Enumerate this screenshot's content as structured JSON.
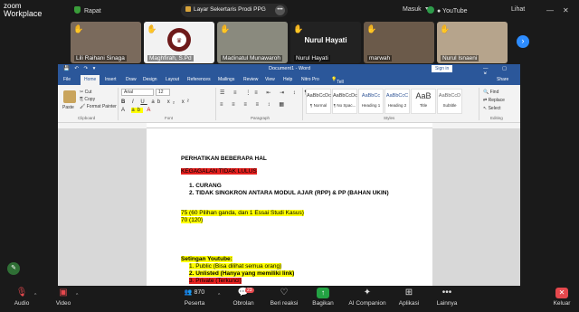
{
  "app": {
    "logo_line1": "zoom",
    "logo_line2": "Workplace"
  },
  "meeting": {
    "title": "Rapat"
  },
  "share": {
    "label": "Layar Sekertaris Prodi PPG"
  },
  "topbar": {
    "signin_label": "Masuk",
    "youtube_label": "YouTube",
    "view_label": "Lihat"
  },
  "participants": [
    {
      "name": "Lili Raihani  Sinaga",
      "hand": "✋",
      "bg": "#7a6a5c"
    },
    {
      "name": "Maghfirah, S.Pd",
      "hand": "✋",
      "bg": "#f2f2f2"
    },
    {
      "name": "Madinatul Munawaroh",
      "hand": "✋",
      "bg": "#8a8a7e"
    },
    {
      "name": "Nurul Hayati",
      "hand": "✋",
      "bg": "#222",
      "big_name": "Nurul Hayati"
    },
    {
      "name": "marwah",
      "hand": "✋",
      "bg": "#6b5a4a"
    },
    {
      "name": "Nurul Isnaeni",
      "hand": "✋",
      "bg": "#b6a48c"
    }
  ],
  "word": {
    "window_title": "Document1  -  Word",
    "signin": "Sign in",
    "share": "Share",
    "tabs": [
      "File",
      "Home",
      "Insert",
      "Draw",
      "Design",
      "Layout",
      "References",
      "Mailings",
      "Review",
      "View",
      "Help",
      "Nitro Pro",
      "Tell me what you want to do"
    ],
    "font": "Arial",
    "font_size": "12",
    "clipboard": {
      "paste": "Paste",
      "cut": "Cut",
      "copy": "Copy",
      "format_painter": "Format Painter",
      "group": "Clipboard"
    },
    "groups": {
      "font": "Font",
      "paragraph": "Paragraph",
      "styles": "Styles",
      "editing": "Editing"
    },
    "styles": [
      {
        "sample": "AaBbCcDc",
        "name": "¶ Normal"
      },
      {
        "sample": "AaBbCcDc",
        "name": "¶ No Spac..."
      },
      {
        "sample": "AaBbCc",
        "name": "Heading 1"
      },
      {
        "sample": "AaBbCcC",
        "name": "Heading 2"
      },
      {
        "sample": "AaB",
        "name": "Title"
      },
      {
        "sample": "AaBbCcD",
        "name": "Subtitle"
      }
    ],
    "editing": {
      "find": "Find",
      "replace": "Replace",
      "select": "Select"
    },
    "doc": {
      "line1": "PERHATIKAN BEBERAPA HAL",
      "line2": "KEGAGALAN TIDAK LULUS",
      "list1": "1.   CURANG",
      "list2": "2.   TIDAK SINGKRON ANTARA MODUL AJAR (RPP) & PP (BAHAN UKIN)",
      "line3": "75 (60 Pilihan ganda, dan 1 Essai Studi Kasus)",
      "line4": "70 (120)",
      "line5": "Setingan Youtube:",
      "yt1": "1.   Public (Bisa dilihat semua orang)",
      "yt2": "2.   Unlisted (Hanya yang memiliki link)",
      "yt3": "3.   Private (Terkunci)"
    }
  },
  "toolbar": {
    "audio": "Audio",
    "video": "Video",
    "participants": "Peserta",
    "participant_count": "870",
    "chat": "Obrolan",
    "chat_badge": "23",
    "reactions": "Beri reaksi",
    "share": "Bagikan",
    "ai": "AI Companion",
    "apps": "Aplikasi",
    "more": "Lainnya",
    "leave": "Keluar"
  }
}
